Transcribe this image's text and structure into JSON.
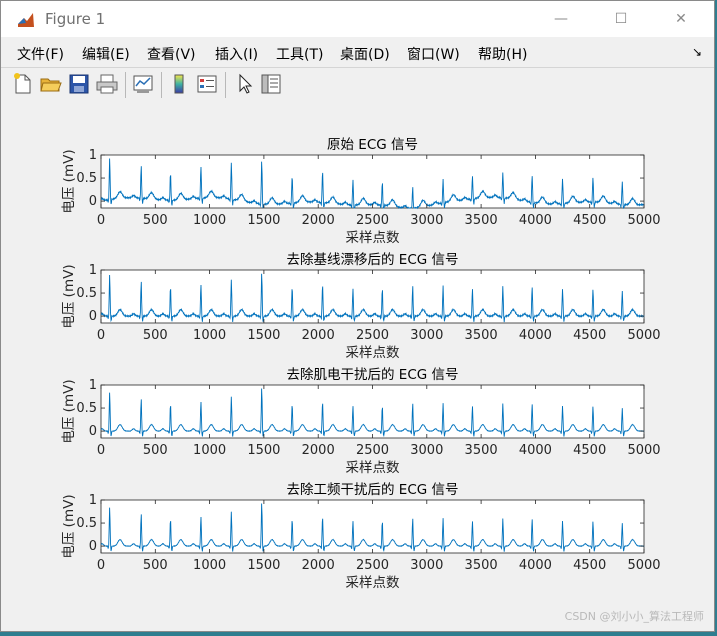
{
  "window": {
    "title": "Figure 1",
    "controls": [
      "—",
      "☐",
      "✕"
    ]
  },
  "menu": {
    "items": [
      "文件(F)",
      "编辑(E)",
      "查看(V)",
      "插入(I)",
      "工具(T)",
      "桌面(D)",
      "窗口(W)",
      "帮助(H)"
    ],
    "dock_glyph": "↘"
  },
  "toolbar": {
    "icons": [
      "new-figure-icon",
      "open-file-icon",
      "save-icon",
      "print-icon",
      "link-plot-icon",
      "colorbar-icon",
      "legend-icon",
      "pointer-icon",
      "property-inspector-icon"
    ]
  },
  "chart_data": [
    {
      "type": "line",
      "title": "原始 ECG 信号",
      "xlabel": "采样点数",
      "ylabel": "电压 (mV)",
      "xlim": [
        0,
        5000
      ],
      "ylim": [
        -0.15,
        1
      ],
      "xticks": [
        "0",
        "500",
        "1000",
        "1500",
        "2000",
        "2500",
        "3000",
        "3500",
        "4000",
        "4500",
        "5000"
      ],
      "yticks": [
        "0",
        "0.5",
        "1"
      ],
      "series": [
        {
          "color": "#0072bd",
          "beats_x": [
            80,
            370,
            640,
            920,
            1200,
            1480,
            1760,
            2040,
            2320,
            2590,
            2870,
            3150,
            3420,
            3700,
            3970,
            4250,
            4530,
            4800
          ],
          "peak_y": [
            0.9,
            0.7,
            0.6,
            0.7,
            0.8,
            0.95,
            0.6,
            0.7,
            0.55,
            0.5,
            0.45,
            0.5,
            0.5,
            0.55,
            0.6,
            0.55,
            0.55,
            0.5
          ],
          "baseline_wander": true
        }
      ]
    },
    {
      "type": "line",
      "title": "去除基线漂移后的 ECG 信号",
      "xlabel": "采样点数",
      "ylabel": "电压 (mV)",
      "xlim": [
        0,
        5000
      ],
      "ylim": [
        -0.15,
        1
      ],
      "xticks": [
        "0",
        "500",
        "1000",
        "1500",
        "2000",
        "2500",
        "3000",
        "3500",
        "4000",
        "4500",
        "5000"
      ],
      "yticks": [
        "0",
        "0.5",
        "1"
      ],
      "series": [
        {
          "color": "#0072bd",
          "beats_x": [
            80,
            370,
            640,
            920,
            1200,
            1480,
            1760,
            2040,
            2320,
            2590,
            2870,
            3150,
            3420,
            3700,
            3970,
            4250,
            4530,
            4800
          ],
          "peak_y": [
            0.9,
            0.75,
            0.65,
            0.7,
            0.8,
            0.95,
            0.65,
            0.7,
            0.6,
            0.6,
            0.65,
            0.65,
            0.6,
            0.65,
            0.65,
            0.6,
            0.6,
            0.55
          ],
          "baseline_wander": false
        }
      ]
    },
    {
      "type": "line",
      "title": "去除肌电干扰后的 ECG 信号",
      "xlabel": "采样点数",
      "ylabel": "电压 (mV)",
      "xlim": [
        0,
        5000
      ],
      "ylim": [
        -0.15,
        1
      ],
      "xticks": [
        "0",
        "500",
        "1000",
        "1500",
        "2000",
        "2500",
        "3000",
        "3500",
        "4000",
        "4500",
        "5000"
      ],
      "yticks": [
        "0",
        "0.5",
        "1"
      ],
      "series": [
        {
          "color": "#0072bd",
          "beats_x": [
            80,
            370,
            640,
            920,
            1200,
            1480,
            1760,
            2040,
            2320,
            2590,
            2870,
            3150,
            3420,
            3700,
            3970,
            4250,
            4530,
            4800
          ],
          "peak_y": [
            0.85,
            0.7,
            0.6,
            0.65,
            0.75,
            0.95,
            0.6,
            0.65,
            0.55,
            0.55,
            0.6,
            0.6,
            0.55,
            0.6,
            0.6,
            0.55,
            0.55,
            0.5
          ],
          "baseline_wander": false
        }
      ]
    },
    {
      "type": "line",
      "title": "去除工频干扰后的 ECG 信号",
      "xlabel": "采样点数",
      "ylabel": "电压 (mV)",
      "xlim": [
        0,
        5000
      ],
      "ylim": [
        -0.15,
        1
      ],
      "xticks": [
        "0",
        "500",
        "1000",
        "1500",
        "2000",
        "2500",
        "3000",
        "3500",
        "4000",
        "4500",
        "5000"
      ],
      "yticks": [
        "0",
        "0.5",
        "1"
      ],
      "series": [
        {
          "color": "#0072bd",
          "beats_x": [
            80,
            370,
            640,
            920,
            1200,
            1480,
            1760,
            2040,
            2320,
            2590,
            2870,
            3150,
            3420,
            3700,
            3970,
            4250,
            4530,
            4800
          ],
          "peak_y": [
            0.85,
            0.7,
            0.6,
            0.65,
            0.75,
            0.95,
            0.6,
            0.65,
            0.55,
            0.55,
            0.6,
            0.6,
            0.55,
            0.6,
            0.6,
            0.55,
            0.55,
            0.5
          ],
          "baseline_wander": false
        }
      ]
    }
  ],
  "watermark": "CSDN @刘小小_算法工程师"
}
